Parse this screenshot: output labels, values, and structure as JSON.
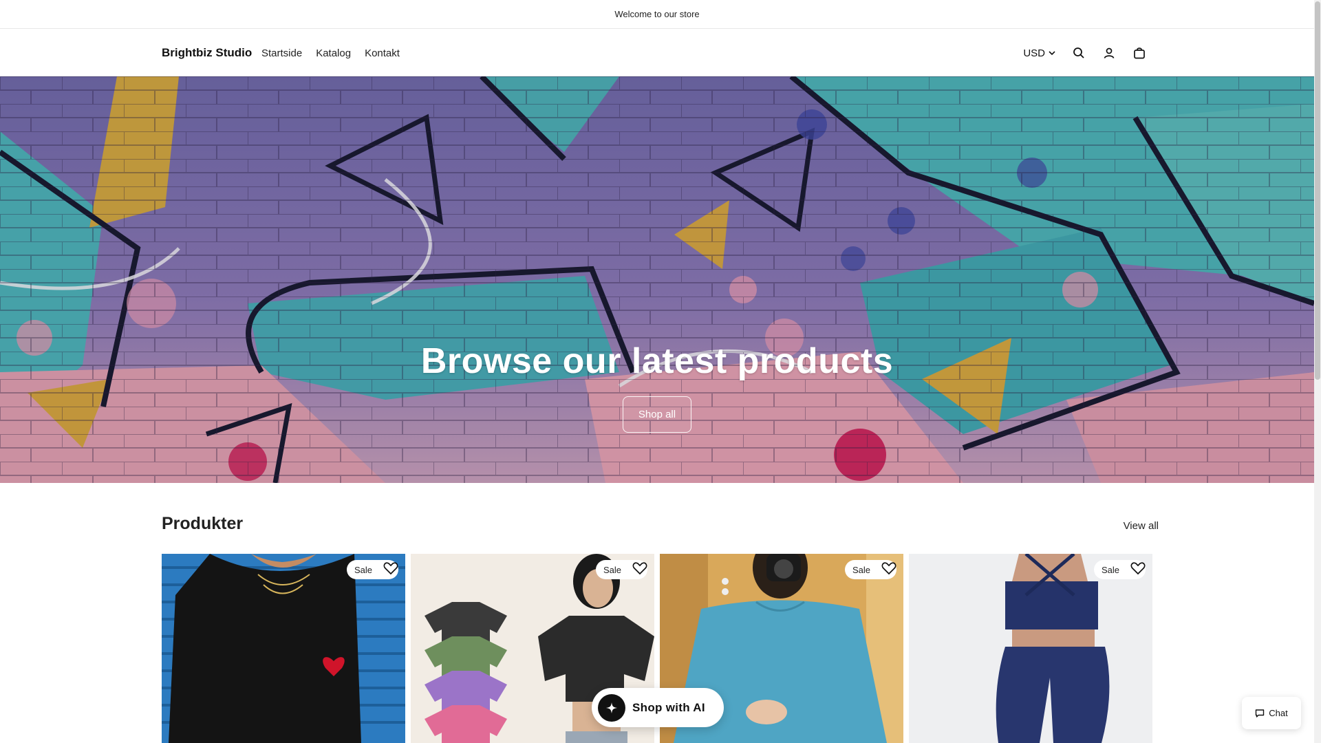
{
  "announcement": {
    "text": "Welcome to our store"
  },
  "header": {
    "logo": "Brightbiz Studio",
    "nav": [
      "Startside",
      "Katalog",
      "Kontakt"
    ],
    "currency": "USD"
  },
  "hero": {
    "title": "Browse our latest products",
    "button_label": "Shop all"
  },
  "products_section": {
    "title": "Produkter",
    "view_all": "View all",
    "items": [
      {
        "badge": "Sale",
        "image": "black-sweater-heart-photo"
      },
      {
        "badge": "Sale",
        "image": "washed-tshirts-photo"
      },
      {
        "badge": "Sale",
        "image": "blue-sweater-photo"
      },
      {
        "badge": "Sale",
        "image": "navy-activewear-photo"
      }
    ]
  },
  "floating": {
    "ai_button": "Shop with AI",
    "chat_button": "Chat"
  },
  "icons": {
    "search": "search-icon",
    "account": "user-icon",
    "cart": "bag-icon",
    "favorite": "heart-icon",
    "sparkle": "sparkle-icon",
    "chat": "chat-bubble-icon"
  }
}
